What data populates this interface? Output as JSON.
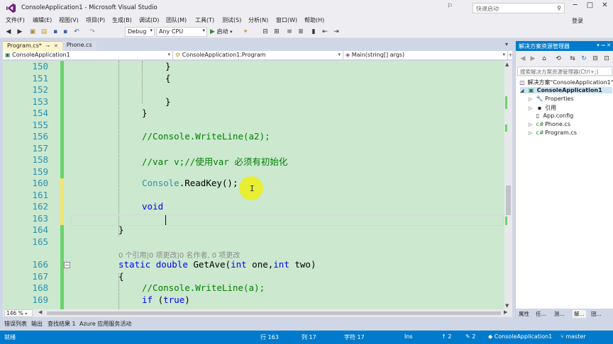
{
  "window": {
    "title": "ConsoleApplication1 - Microsoft Visual Studio",
    "quick_launch_placeholder": "快速启动",
    "login": "登录",
    "min": "─",
    "max": "□",
    "close": "✕"
  },
  "menu": [
    "文件(F)",
    "编辑(E)",
    "视图(V)",
    "项目(P)",
    "生成(B)",
    "调试(D)",
    "团队(M)",
    "工具(T)",
    "测试(S)",
    "分析(N)",
    "窗口(W)",
    "帮助(H)"
  ],
  "toolbar": {
    "config": "Debug",
    "platform": "Any CPU",
    "start": "启动"
  },
  "tabs": [
    {
      "label": "Program.cs*",
      "active": true
    },
    {
      "label": "Phone.cs",
      "active": false
    }
  ],
  "navbar": {
    "project": "ConsoleApplication1",
    "class": "ConsoleApplication1.Program",
    "member": "Main(string[] args)"
  },
  "editor": {
    "line_numbers": [
      "150",
      "151",
      "152",
      "153",
      "154",
      "155",
      "156",
      "157",
      "158",
      "159",
      "160",
      "161",
      "162",
      "163",
      "164",
      "165",
      "166",
      "167",
      "168",
      "169"
    ],
    "code": {
      "l150": "}",
      "l151": "{",
      "l153": "}",
      "l154": "}",
      "l156": "//Console.WriteLine(a2);",
      "l158": "//var v;//使用var 必须有初始化",
      "l160_type": "Console",
      "l160_rest": ".ReadKey();",
      "l162": "void",
      "l164": "}",
      "lens": "0 个引用|0 项更改|0 名作者, 0 项更改",
      "l166_kw1": "static",
      "l166_kw2": "double",
      "l166_name": " GetAve(",
      "l166_kw3": "int",
      "l166_p1": " one,",
      "l166_kw4": "int",
      "l166_p2": " two)",
      "l167": "{",
      "l168": "//Console.WriteLine(a);",
      "l169_kw": "if",
      "l169_rest": " (",
      "l169_kw2": "true",
      "l169_end": ")"
    },
    "zoom": "146 %"
  },
  "bottom_tabs": [
    "错误列表",
    "输出",
    "查找结果 1",
    "Azure 应用服务活动"
  ],
  "status": {
    "ready": "就绪",
    "line": "行 163",
    "col": "列 17",
    "char": "字符 17",
    "ins": "Ins",
    "up": "↑ 2",
    "edits": "✎ 2",
    "repo": "ConsoleApplication1",
    "branch": "master"
  },
  "solution_explorer": {
    "title": "解决方案资源管理器",
    "search_placeholder": "搜索解决方案资源管理器(Ctrl+;)",
    "items": [
      {
        "label": "解决方案\"ConsoleApplication1\""
      },
      {
        "label": "ConsoleApplication1"
      },
      {
        "label": "Properties"
      },
      {
        "label": "引用"
      },
      {
        "label": "App.config"
      },
      {
        "label": "Phone.cs"
      },
      {
        "label": "Program.cs"
      }
    ],
    "bottom_tabs": [
      "属性",
      "任...",
      "测...",
      "解...",
      "团..."
    ]
  },
  "colors": {
    "accent": "#007acc",
    "editor_bg": "#cce8cf",
    "change_saved": "#6bd36b",
    "change_unsaved": "#f1e66c"
  }
}
